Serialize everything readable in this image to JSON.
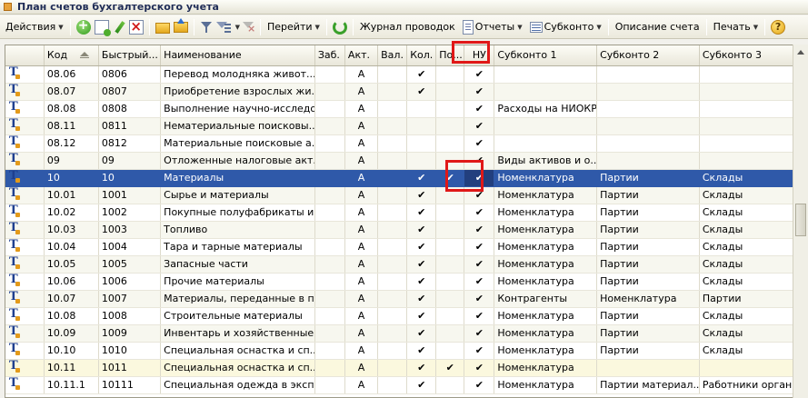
{
  "window": {
    "title": "План счетов бухгалтерского учета"
  },
  "toolbar": {
    "actions_label": "Действия",
    "goto_label": "Перейти",
    "journal_label": "Журнал проводок",
    "reports_label": "Отчеты",
    "subkonto_label": "Субконто",
    "account_desc_label": "Описание счета",
    "print_label": "Печать"
  },
  "columns": {
    "code": "Код",
    "quick": "Быстрый...",
    "name": "Наименование",
    "zab": "Заб.",
    "akt": "Акт.",
    "val": "Вал.",
    "kol": "Кол.",
    "po": "По...",
    "nu": "НУ",
    "s1": "Субконто 1",
    "s2": "Субконто 2",
    "s3": "Субконто 3"
  },
  "check_mark": "✔",
  "rows": [
    {
      "code": "08.06",
      "quick": "0806",
      "name": "Перевод молодняка живот...",
      "akt": "А",
      "kol": "✔",
      "po": "",
      "nu": "✔",
      "s1": "",
      "s2": "",
      "s3": ""
    },
    {
      "code": "08.07",
      "quick": "0807",
      "name": "Приобретение взрослых жи...",
      "akt": "А",
      "kol": "✔",
      "po": "",
      "nu": "✔",
      "s1": "",
      "s2": "",
      "s3": ""
    },
    {
      "code": "08.08",
      "quick": "0808",
      "name": "Выполнение научно-исследо...",
      "akt": "А",
      "kol": "",
      "po": "",
      "nu": "✔",
      "s1": "Расходы на НИОКР",
      "s2": "",
      "s3": ""
    },
    {
      "code": "08.11",
      "quick": "0811",
      "name": "Нематериальные поисковы...",
      "akt": "А",
      "kol": "",
      "po": "",
      "nu": "✔",
      "s1": "",
      "s2": "",
      "s3": ""
    },
    {
      "code": "08.12",
      "quick": "0812",
      "name": "Материальные поисковые а...",
      "akt": "А",
      "kol": "",
      "po": "",
      "nu": "✔",
      "s1": "",
      "s2": "",
      "s3": ""
    },
    {
      "code": "09",
      "quick": "09",
      "name": "Отложенные налоговые акт...",
      "akt": "А",
      "kol": "",
      "po": "",
      "nu": "✔",
      "s1": "Виды активов и о...",
      "s2": "",
      "s3": ""
    },
    {
      "code": "10",
      "quick": "10",
      "name": "Материалы",
      "akt": "А",
      "kol": "✔",
      "po": "✔",
      "nu": "✔",
      "s1": "Номенклатура",
      "s2": "Партии",
      "s3": "Склады"
    },
    {
      "code": "10.01",
      "quick": "1001",
      "name": "Сырье и материалы",
      "akt": "А",
      "kol": "✔",
      "po": "",
      "nu": "✔",
      "s1": "Номенклатура",
      "s2": "Партии",
      "s3": "Склады"
    },
    {
      "code": "10.02",
      "quick": "1002",
      "name": "Покупные полуфабрикаты и ...",
      "akt": "А",
      "kol": "✔",
      "po": "",
      "nu": "✔",
      "s1": "Номенклатура",
      "s2": "Партии",
      "s3": "Склады"
    },
    {
      "code": "10.03",
      "quick": "1003",
      "name": "Топливо",
      "akt": "А",
      "kol": "✔",
      "po": "",
      "nu": "✔",
      "s1": "Номенклатура",
      "s2": "Партии",
      "s3": "Склады"
    },
    {
      "code": "10.04",
      "quick": "1004",
      "name": "Тара и тарные материалы",
      "akt": "А",
      "kol": "✔",
      "po": "",
      "nu": "✔",
      "s1": "Номенклатура",
      "s2": "Партии",
      "s3": "Склады"
    },
    {
      "code": "10.05",
      "quick": "1005",
      "name": "Запасные части",
      "akt": "А",
      "kol": "✔",
      "po": "",
      "nu": "✔",
      "s1": "Номенклатура",
      "s2": "Партии",
      "s3": "Склады"
    },
    {
      "code": "10.06",
      "quick": "1006",
      "name": "Прочие материалы",
      "akt": "А",
      "kol": "✔",
      "po": "",
      "nu": "✔",
      "s1": "Номенклатура",
      "s2": "Партии",
      "s3": "Склады"
    },
    {
      "code": "10.07",
      "quick": "1007",
      "name": "Материалы, переданные в п...",
      "akt": "А",
      "kol": "✔",
      "po": "",
      "nu": "✔",
      "s1": "Контрагенты",
      "s2": "Номенклатура",
      "s3": "Партии"
    },
    {
      "code": "10.08",
      "quick": "1008",
      "name": "Строительные материалы",
      "akt": "А",
      "kol": "✔",
      "po": "",
      "nu": "✔",
      "s1": "Номенклатура",
      "s2": "Партии",
      "s3": "Склады"
    },
    {
      "code": "10.09",
      "quick": "1009",
      "name": "Инвентарь и хозяйственные...",
      "akt": "А",
      "kol": "✔",
      "po": "",
      "nu": "✔",
      "s1": "Номенклатура",
      "s2": "Партии",
      "s3": "Склады"
    },
    {
      "code": "10.10",
      "quick": "1010",
      "name": "Специальная оснастка и сп...",
      "akt": "А",
      "kol": "✔",
      "po": "",
      "nu": "✔",
      "s1": "Номенклатура",
      "s2": "Партии",
      "s3": "Склады"
    },
    {
      "code": "10.11",
      "quick": "1011",
      "name": "Специальная оснастка и сп...",
      "akt": "А",
      "kol": "✔",
      "po": "✔",
      "nu": "✔",
      "s1": "Номенклатура",
      "s2": "",
      "s3": ""
    },
    {
      "code": "10.11.1",
      "quick": "10111",
      "name": "Специальная одежда в эксп...",
      "akt": "А",
      "kol": "✔",
      "po": "",
      "nu": "✔",
      "s1": "Номенклатура",
      "s2": "Партии материал...",
      "s3": "Работники органи..."
    }
  ]
}
